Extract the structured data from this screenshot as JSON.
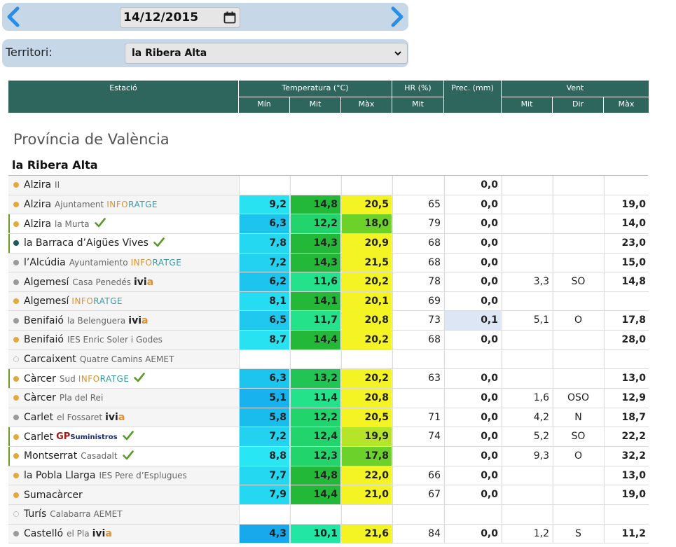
{
  "date_nav": {
    "date_value": "14/12/2015",
    "prev_icon": "chevron-left-icon",
    "next_icon": "chevron-right-icon",
    "calendar_icon": "calendar-icon"
  },
  "territori": {
    "label": "Territori:",
    "selected": "la Ribera Alta",
    "icon": "chevron-down-icon"
  },
  "table_header": {
    "estacio": "Estació",
    "temperatura": "Temperatura (°C)",
    "hr": "HR (%)",
    "prec": "Prec. (mm)",
    "vent": "Vent",
    "t_min": "Mín",
    "t_mit": "Mit",
    "t_max": "Màx",
    "hr_mit": "Mit",
    "v_mit": "Mit",
    "v_dir": "Dir",
    "v_max": "Màx"
  },
  "province_title": "Província de València",
  "comarca_title": "la Ribera Alta",
  "colors": {
    "header_bg": "#2e665d",
    "dot_orange": "#e5a83a",
    "dot_gray": "#9a9a9a",
    "dot_teal": "#1e5a5a",
    "check_green": "#5a9a28",
    "prec_highlight": "#dde6f4"
  },
  "stations": [
    {
      "name": "Alzira",
      "sub": "II",
      "brand": "",
      "check": false,
      "dot": "orange",
      "hl": false,
      "tmin": "",
      "tmit": "",
      "tmax": "",
      "hr": "",
      "prec": "0,0",
      "vmit": "",
      "vdir": "",
      "vmax": "",
      "cmin": "",
      "cmit": "",
      "cmax": "",
      "cprec": ""
    },
    {
      "name": "Alzira",
      "sub": "Ajuntament",
      "brand": "INFORATGE",
      "check": false,
      "dot": "orange",
      "hl": false,
      "tmin": "9,2",
      "tmit": "14,8",
      "tmax": "20,5",
      "hr": "65",
      "prec": "0,0",
      "vmit": "",
      "vdir": "",
      "vmax": "19,0",
      "cmin": "#28e2f2",
      "cmit": "#24b838",
      "cmax": "#f4f424",
      "cprec": ""
    },
    {
      "name": "Alzira",
      "sub": "la Murta",
      "brand": "",
      "check": true,
      "dot": "orange",
      "hl": true,
      "tmin": "6,3",
      "tmit": "12,2",
      "tmax": "18,0",
      "hr": "79",
      "prec": "0,0",
      "vmit": "",
      "vdir": "",
      "vmax": "14,0",
      "cmin": "#1cc4ee",
      "cmit": "#22d46c",
      "cmax": "#6cd22a",
      "cprec": ""
    },
    {
      "name": "la Barraca d’Aigües Vives",
      "sub": "",
      "brand": "",
      "check": true,
      "dot": "teal",
      "hl": true,
      "tmin": "7,8",
      "tmit": "14,3",
      "tmax": "20,9",
      "hr": "68",
      "prec": "0,0",
      "vmit": "",
      "vdir": "",
      "vmax": "23,0",
      "cmin": "#24d8f2",
      "cmit": "#24b838",
      "cmax": "#f4f424",
      "cprec": ""
    },
    {
      "name": "l’Alcúdia",
      "sub": "Ayuntamiento",
      "brand": "INFORATGE",
      "check": false,
      "dot": "gray",
      "hl": false,
      "tmin": "7,2",
      "tmit": "14,3",
      "tmax": "21,5",
      "hr": "68",
      "prec": "0,0",
      "vmit": "",
      "vdir": "",
      "vmax": "15,0",
      "cmin": "#22d2f0",
      "cmit": "#24b838",
      "cmax": "#f4f424",
      "cprec": ""
    },
    {
      "name": "Algemesí",
      "sub": "Casa Penedés",
      "brand": "ivia",
      "check": false,
      "dot": "gray",
      "hl": false,
      "tmin": "6,2",
      "tmit": "11,6",
      "tmax": "20,2",
      "hr": "78",
      "prec": "0,0",
      "vmit": "3,3",
      "vdir": "SO",
      "vmax": "14,8",
      "cmin": "#1cc4ee",
      "cmit": "#24e28a",
      "cmax": "#f4f424",
      "cprec": ""
    },
    {
      "name": "Algemesí",
      "sub": "",
      "brand": "INFORATGE",
      "check": false,
      "dot": "orange",
      "hl": false,
      "tmin": "8,1",
      "tmit": "14,1",
      "tmax": "20,1",
      "hr": "69",
      "prec": "0,0",
      "vmit": "",
      "vdir": "",
      "vmax": "",
      "cmin": "#26dcf2",
      "cmit": "#24b838",
      "cmax": "#f4f424",
      "cprec": ""
    },
    {
      "name": "Benifaió",
      "sub": "la Belenguera",
      "brand": "ivia",
      "check": false,
      "dot": "gray",
      "hl": false,
      "tmin": "6,5",
      "tmit": "11,7",
      "tmax": "20,8",
      "hr": "73",
      "prec": "0,1",
      "vmit": "5,1",
      "vdir": "O",
      "vmax": "17,8",
      "cmin": "#1ec8ee",
      "cmit": "#24e28a",
      "cmax": "#f4f424",
      "cprec": "#dde6f4"
    },
    {
      "name": "Benifaió",
      "sub": "IES Enric Soler i Godes",
      "brand": "",
      "check": false,
      "dot": "orange",
      "hl": false,
      "tmin": "8,7",
      "tmit": "14,4",
      "tmax": "20,2",
      "hr": "68",
      "prec": "0,0",
      "vmit": "",
      "vdir": "",
      "vmax": "28,0",
      "cmin": "#28e2f2",
      "cmit": "#24b838",
      "cmax": "#f4f424",
      "cprec": ""
    },
    {
      "name": "Carcaixent",
      "sub": "Quatre Camins AEMET",
      "brand": "",
      "check": false,
      "dot": "hollow",
      "hl": false,
      "tmin": "",
      "tmit": "",
      "tmax": "",
      "hr": "",
      "prec": "",
      "vmit": "",
      "vdir": "",
      "vmax": "",
      "cmin": "",
      "cmit": "",
      "cmax": "",
      "cprec": ""
    },
    {
      "name": "Càrcer",
      "sub": "Sud",
      "brand": "INFORATGE",
      "check": true,
      "dot": "orange",
      "hl": true,
      "tmin": "6,3",
      "tmit": "13,2",
      "tmax": "20,2",
      "hr": "63",
      "prec": "0,0",
      "vmit": "",
      "vdir": "",
      "vmax": "13,0",
      "cmin": "#1cc4ee",
      "cmit": "#22c456",
      "cmax": "#f4f424",
      "cprec": ""
    },
    {
      "name": "Càrcer",
      "sub": "Pla del Rei",
      "brand": "",
      "check": false,
      "dot": "orange",
      "hl": false,
      "tmin": "5,1",
      "tmit": "11,4",
      "tmax": "20,8",
      "hr": "",
      "prec": "0,0",
      "vmit": "1,6",
      "vdir": "OSO",
      "vmax": "12,9",
      "cmin": "#18b2ee",
      "cmit": "#24e28a",
      "cmax": "#f4f424",
      "cprec": ""
    },
    {
      "name": "Carlet",
      "sub": "el Fossaret",
      "brand": "ivia",
      "check": false,
      "dot": "gray",
      "hl": false,
      "tmin": "5,8",
      "tmit": "12,2",
      "tmax": "20,5",
      "hr": "71",
      "prec": "0,0",
      "vmit": "4,2",
      "vdir": "N",
      "vmax": "18,7",
      "cmin": "#1abcee",
      "cmit": "#22d46c",
      "cmax": "#f4f424",
      "cprec": ""
    },
    {
      "name": "Carlet",
      "sub": "",
      "brand": "GP",
      "check": true,
      "dot": "orange",
      "hl": true,
      "tmin": "7,2",
      "tmit": "12,4",
      "tmax": "19,9",
      "hr": "74",
      "prec": "0,0",
      "vmit": "5,2",
      "vdir": "SO",
      "vmax": "22,2",
      "cmin": "#22d2f0",
      "cmit": "#22d46c",
      "cmax": "#b6e428",
      "cprec": ""
    },
    {
      "name": "Montserrat",
      "sub": "Casadalt",
      "brand": "",
      "check": true,
      "dot": "orange",
      "hl": true,
      "tmin": "8,8",
      "tmit": "12,3",
      "tmax": "17,8",
      "hr": "",
      "prec": "0,0",
      "vmit": "9,3",
      "vdir": "O",
      "vmax": "32,2",
      "cmin": "#28e6f4",
      "cmit": "#22d46c",
      "cmax": "#6cd22a",
      "cprec": ""
    },
    {
      "name": "la Pobla Llarga",
      "sub": "IES Pere d’Esplugues",
      "brand": "",
      "check": false,
      "dot": "orange",
      "hl": false,
      "tmin": "7,7",
      "tmit": "14,8",
      "tmax": "22,0",
      "hr": "66",
      "prec": "0,0",
      "vmit": "",
      "vdir": "",
      "vmax": "13,0",
      "cmin": "#24d8f2",
      "cmit": "#24b838",
      "cmax": "#f4f424",
      "cprec": ""
    },
    {
      "name": "Sumacàrcer",
      "sub": "",
      "brand": "",
      "check": false,
      "dot": "orange",
      "hl": false,
      "tmin": "7,9",
      "tmit": "14,4",
      "tmax": "21,0",
      "hr": "67",
      "prec": "0,0",
      "vmit": "",
      "vdir": "",
      "vmax": "19,0",
      "cmin": "#24d8f2",
      "cmit": "#24b838",
      "cmax": "#f4f424",
      "cprec": ""
    },
    {
      "name": "Turís",
      "sub": "Calabarra AEMET",
      "brand": "",
      "check": false,
      "dot": "hollow",
      "hl": false,
      "tmin": "",
      "tmit": "",
      "tmax": "",
      "hr": "",
      "prec": "",
      "vmit": "",
      "vdir": "",
      "vmax": "",
      "cmin": "",
      "cmit": "",
      "cmax": "",
      "cprec": ""
    },
    {
      "name": "Castelló",
      "sub": "el Pla",
      "brand": "ivia",
      "check": false,
      "dot": "gray",
      "hl": false,
      "tmin": "4,3",
      "tmit": "10,1",
      "tmax": "21,6",
      "hr": "84",
      "prec": "0,0",
      "vmit": "1,2",
      "vdir": "S",
      "vmax": "11,2",
      "cmin": "#18a8ec",
      "cmit": "#22e6a4",
      "cmax": "#f4f424",
      "cprec": ""
    }
  ]
}
